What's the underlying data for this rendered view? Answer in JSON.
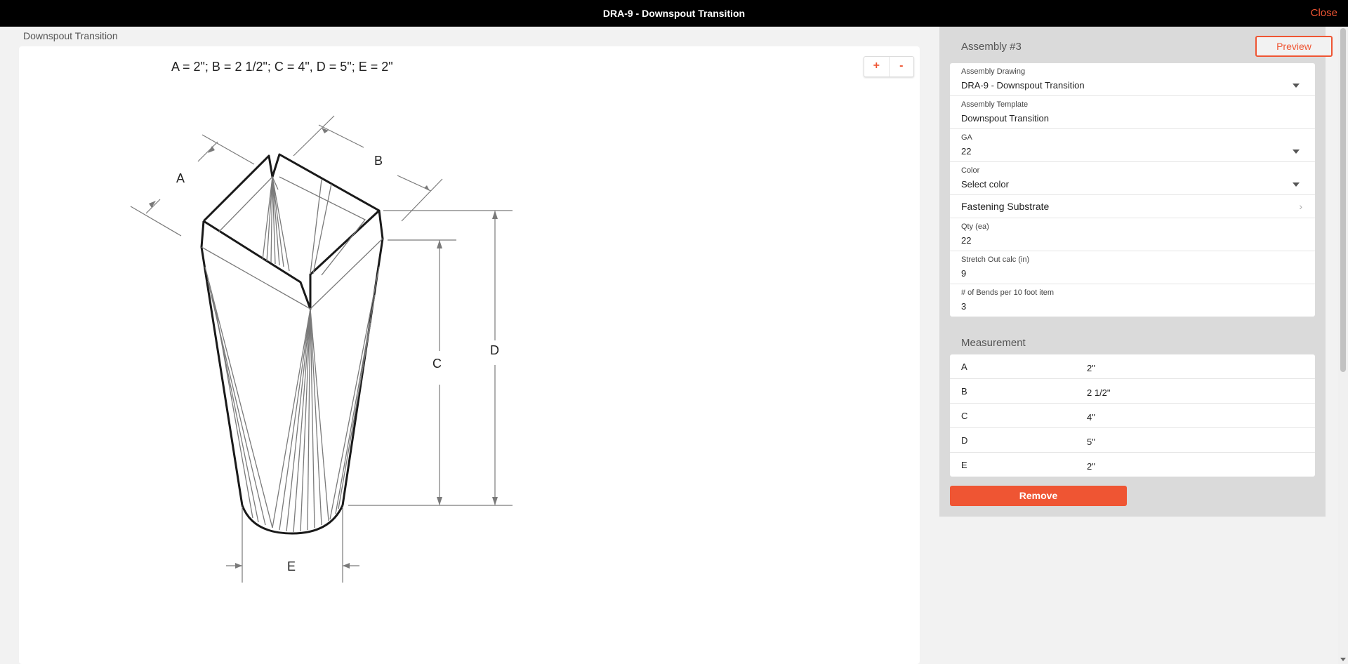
{
  "window": {
    "title": "DRA-9 - Downspout Transition",
    "close_label": "Close"
  },
  "left": {
    "title": "Downspout Transition",
    "formula": "A = 2\"; B = 2 1/2\"; C = 4\", D = 5\"; E = 2\"",
    "zoom_in_label": "+",
    "zoom_out_label": "-",
    "drawing_labels": {
      "a": "A",
      "b": "B",
      "c": "C",
      "d": "D",
      "e": "E"
    }
  },
  "assembly": {
    "title": "Assembly #3",
    "preview_label": "Preview",
    "fields": {
      "drawing": {
        "label": "Assembly Drawing",
        "value": "DRA-9 - Downspout Transition"
      },
      "template": {
        "label": "Assembly Template",
        "value": "Downspout Transition"
      },
      "ga": {
        "label": "GA",
        "value": "22"
      },
      "color": {
        "label": "Color",
        "value": "Select color"
      },
      "fastening": {
        "label": "Fastening Substrate"
      },
      "qty": {
        "label": "Qty (ea)",
        "value": "22"
      },
      "stretch": {
        "label": "Stretch Out calc (in)",
        "value": "9"
      },
      "bends": {
        "label": "# of Bends per 10 foot item",
        "value": "3"
      }
    },
    "measurement_title": "Measurement",
    "measurements": [
      {
        "key": "A",
        "value": "2\""
      },
      {
        "key": "B",
        "value": "2 1/2\""
      },
      {
        "key": "C",
        "value": "4\""
      },
      {
        "key": "D",
        "value": "5\""
      },
      {
        "key": "E",
        "value": "2\""
      }
    ],
    "remove_label": "Remove"
  },
  "colors": {
    "accent": "#ef5533",
    "topbar": "#000000",
    "panel": "#dadada"
  }
}
